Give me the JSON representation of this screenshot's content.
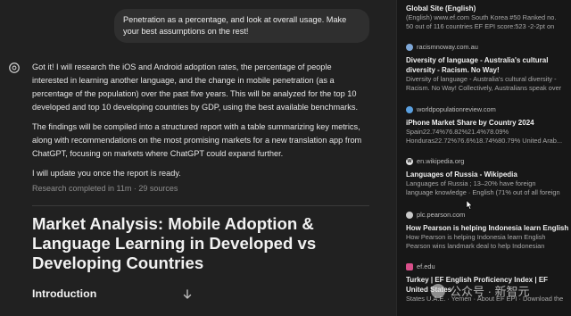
{
  "chat": {
    "user_message": "Penetration as a percentage, and look at overall usage. Make your best assumptions on the rest!",
    "assistant_paragraphs": [
      "Got it! I will research the iOS and Android adoption rates, the percentage of people interested in learning another language, and the change in mobile penetration (as a percentage of the population) over the past five years. This will be analyzed for the top 10 developed and top 10 developing countries by GDP, using the best available benchmarks.",
      "The findings will be compiled into a structured report with a table summarizing key metrics, along with recommendations on the most promising markets for a new translation app from ChatGPT, focusing on markets where ChatGPT could expand further.",
      "I will update you once the report is ready."
    ],
    "research_meta": "Research completed in 11m · 29 sources",
    "report_title": "Market Analysis: Mobile Adoption & Language Learning in Developed vs Developing Countries",
    "section_heading": "Introduction"
  },
  "sources": [
    {
      "domain": "",
      "title": "Global Site (English)",
      "desc": [
        "(English) www.ef.com South Korea #50 Ranked no.",
        "50 out of 116 countries EF EPI score:523 -2-2pt on"
      ],
      "icon": "globe-icon",
      "icon_color": "#9a9a9a"
    },
    {
      "domain": "racismnoway.com.au",
      "title": "Diversity of language - Australia's cultural diversity - Racism. No Way!",
      "desc": [
        "Diversity of language - Australia's cultural diversity -",
        "Racism. No Way! Collectively, Australians speak over"
      ],
      "icon": "racismnoway-favicon",
      "icon_color": "#7fa8d8"
    },
    {
      "domain": "worldpopulationreview.com",
      "title": "iPhone Market Share by Country 2024",
      "desc": [
        "Spain22.74%76.82%21.4%78.09%",
        "Honduras22.72%76.6%18.74%80.79% United Arab..."
      ],
      "icon": "worldpopulationreview-favicon",
      "icon_color": "#5aa0e0"
    },
    {
      "domain": "en.wikipedia.org",
      "title": "Languages of Russia - Wikipedia",
      "desc": [
        "Languages of Russia ; 13–20% have foreign",
        "language knowledge · English (71% out of all foreign"
      ],
      "icon": "wikipedia-favicon",
      "icon_color": "#e0e0e0"
    },
    {
      "domain": "plc.pearson.com",
      "title": "How Pearson is helping Indonesia learn English",
      "desc": [
        "How Pearson is helping Indonesia learn English",
        "Pearson wins landmark deal to help Indonesian"
      ],
      "icon": "pearson-favicon",
      "icon_color": "#c9c9c9"
    },
    {
      "domain": "ef.edu",
      "title": "Turkey | EF English Proficiency Index | EF United States",
      "desc": [
        "States U.A.E. · Yemen · About EF EPI · Download the"
      ],
      "icon": "ef-favicon",
      "icon_color": "#d94f8a"
    }
  ],
  "watermark": "公众号 · 新智元"
}
